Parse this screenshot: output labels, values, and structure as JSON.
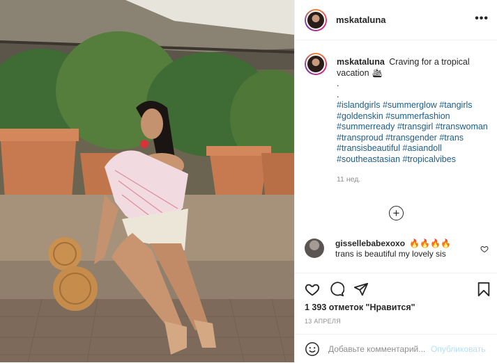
{
  "header": {
    "username": "mskataluna",
    "more_label": "•••"
  },
  "caption": {
    "username": "mskataluna",
    "text": "Craving for a tropical vacation 🛳",
    "dots": [
      ".",
      "."
    ],
    "hashtags": "#islandgirls #summerglow #tangirls #goldenskin #summerfashion #summerready #transgirl #transwoman #transproud #transgender #trans #transisbeautiful #asiandoll #southeastasian #tropicalvibes",
    "time_ago": "11 нед."
  },
  "load_more_label": "+",
  "comment": {
    "username": "gissellebabexoxo",
    "text": "🔥🔥🔥🔥 trans is beautiful my lovely sis"
  },
  "actions": {
    "likes": "1 393 отметок \"Нравится\"",
    "date": "13 АПРЕЛЯ"
  },
  "add_comment": {
    "placeholder": "Добавьте комментарий...",
    "publish_label": "Опубликовать"
  },
  "colors": {
    "link": "#1c5c8c",
    "publish_disabled": "#b2dffc",
    "muted": "#8e8e8e"
  }
}
